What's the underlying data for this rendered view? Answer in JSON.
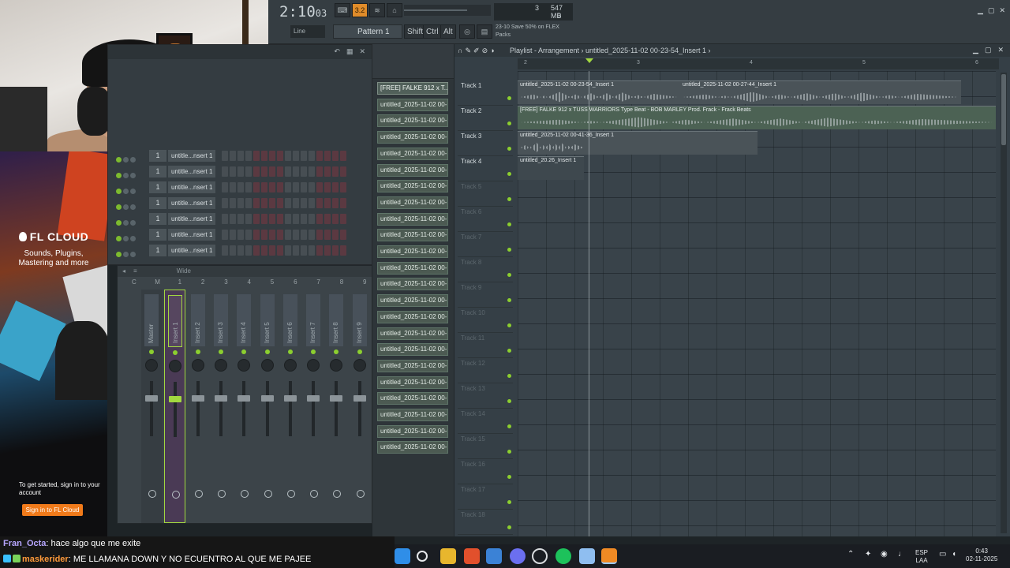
{
  "toolbar": {
    "timecode_main": "2:10",
    "timecode_sub": "03",
    "tempo_btn": "3.2",
    "cpu_value": "3",
    "ram_value": "547 MB",
    "voices_value": "0",
    "snap_mode": "Line",
    "pattern_label": "Pattern 1",
    "keys": [
      "Shift",
      "Ctrl",
      "Alt"
    ],
    "hint_text": "23-10  Save 50% on FLEX Packs"
  },
  "channel_rack": {
    "rows": [
      {
        "num": "1",
        "name": "untitle...nsert 1"
      },
      {
        "num": "1",
        "name": "untitle...nsert 1"
      },
      {
        "num": "1",
        "name": "untitle...nsert 1"
      },
      {
        "num": "1",
        "name": "untitle...nsert 1"
      },
      {
        "num": "1",
        "name": "untitle...nsert 1"
      },
      {
        "num": "1",
        "name": "untitle...nsert 1"
      },
      {
        "num": "1",
        "name": "untitle...nsert 1"
      }
    ]
  },
  "mixer": {
    "top_label": "Wide",
    "header_cols": [
      "C",
      "M",
      "1",
      "2",
      "3",
      "4",
      "5",
      "6",
      "7",
      "8",
      "9"
    ],
    "tracks": [
      "Master",
      "Insert 1",
      "Insert 2",
      "Insert 3",
      "Insert 4",
      "Insert 5",
      "Insert 6",
      "Insert 7",
      "Insert 8",
      "Insert 9"
    ]
  },
  "fl_cloud": {
    "brand": "FL CLOUD",
    "tagline": "Sounds, Plugins, Mastering and more",
    "start_text": "To get started, sign in to your account",
    "signin_label": "Sign in to FL Cloud"
  },
  "browser": {
    "items": [
      "[FREE] FALKE 912 x T...",
      "untitled_2025-11-02 00-...",
      "untitled_2025-11-02 00-...",
      "untitled_2025-11-02 00-...",
      "untitled_2025-11-02 00-...",
      "untitled_2025-11-02 00-...",
      "untitled_2025-11-02 00-...",
      "untitled_2025-11-02 00-...",
      "untitled_2025-11-02 00-...",
      "untitled_2025-11-02 00-...",
      "untitled_2025-11-02 00-...",
      "untitled_2025-11-02 00-...",
      "untitled_2025-11-02 00-...",
      "untitled_2025-11-02 00-...",
      "untitled_2025-11-02 00-...",
      "untitled_2025-11-02 00-...",
      "untitled_2025-11-02 00-...",
      "untitled_2025-11-02 00-...",
      "untitled_2025-11-02 00-...",
      "untitled_2025-11-02 00-...",
      "untitled_2025-11-02 00-...",
      "untitled_2025-11-02 00-...",
      "untitled_2025-11-02 00-..."
    ]
  },
  "playlist": {
    "title": "Playlist - Arrangement › untitled_2025-11-02 00-23-54_Insert 1 ›",
    "ruler": [
      "2",
      "3",
      "4",
      "5",
      "6"
    ],
    "tracks": [
      "Track 1",
      "Track 2",
      "Track 3",
      "Track 4",
      "Track 5",
      "Track 6",
      "Track 7",
      "Track 8",
      "Track 9",
      "Track 10",
      "Track 11",
      "Track 12",
      "Track 13",
      "Track 14",
      "Track 15",
      "Track 16",
      "Track 17",
      "Track 18"
    ],
    "clips": {
      "c1": "untitled_2025-11-02 00-23-54_Insert 1",
      "c2": "untitled_2025-11-02 00-27-44_Insert 1",
      "c3": "[FREE] FALKE 912 x TUSS WARRIORS Type Beat - BOB MARLEY Prod. Frack - Frack Beats",
      "c4": "untitled_2025-11-02 00-41-36_Insert 1",
      "c5": "untitled_20.26_Insert 1"
    }
  },
  "chat": {
    "line1_user": "Fran_Octa",
    "line1_msg": ": hace algo que me exite",
    "line2_user": "maskerider",
    "line2_msg": ": ME LLAMANA DOWN Y NO ECUENTRO AL QUE ME PAJEE"
  },
  "taskbar": {
    "lang1": "ESP",
    "lang2": "LAA",
    "time": "0:43",
    "date": "02-11-2025"
  }
}
